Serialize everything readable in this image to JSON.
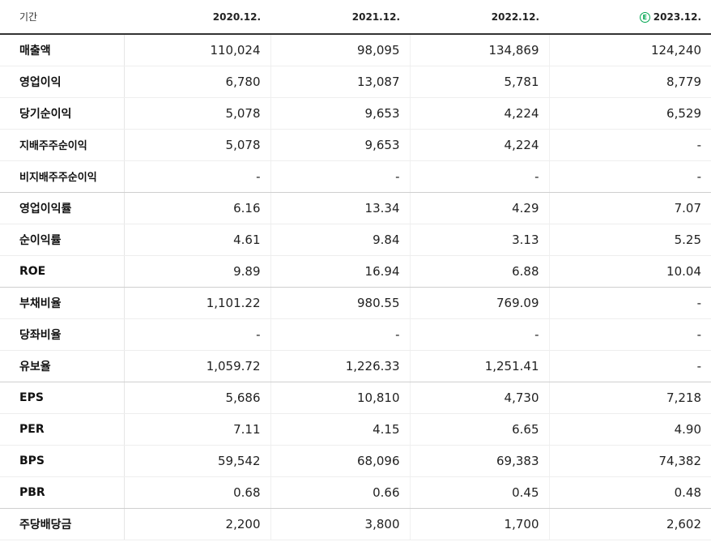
{
  "table": {
    "header": {
      "label": "기간",
      "periods": [
        "2020.12.",
        "2021.12.",
        "2022.12.",
        "2023.12."
      ],
      "estimate_icon": "E"
    },
    "rows": [
      {
        "label": "매출액",
        "values": [
          "110,024",
          "98,095",
          "134,869",
          "124,240"
        ]
      },
      {
        "label": "영업이익",
        "values": [
          "6,780",
          "13,087",
          "5,781",
          "8,779"
        ]
      },
      {
        "label": "당기순이익",
        "values": [
          "5,078",
          "9,653",
          "4,224",
          "6,529"
        ]
      },
      {
        "label": "지배주주순이익",
        "values": [
          "5,078",
          "9,653",
          "4,224",
          "-"
        ]
      },
      {
        "label": "비지배주주순이익",
        "values": [
          "-",
          "-",
          "-",
          "-"
        ]
      },
      {
        "label": "영업이익률",
        "values": [
          "6.16",
          "13.34",
          "4.29",
          "7.07"
        ]
      },
      {
        "label": "순이익률",
        "values": [
          "4.61",
          "9.84",
          "3.13",
          "5.25"
        ]
      },
      {
        "label": "ROE",
        "values": [
          "9.89",
          "16.94",
          "6.88",
          "10.04"
        ]
      },
      {
        "label": "부채비율",
        "values": [
          "1,101.22",
          "980.55",
          "769.09",
          "-"
        ]
      },
      {
        "label": "당좌비율",
        "values": [
          "-",
          "-",
          "-",
          "-"
        ]
      },
      {
        "label": "유보율",
        "values": [
          "1,059.72",
          "1,226.33",
          "1,251.41",
          "-"
        ]
      },
      {
        "label": "EPS",
        "values": [
          "5,686",
          "10,810",
          "4,730",
          "7,218"
        ]
      },
      {
        "label": "PER",
        "values": [
          "7.11",
          "4.15",
          "6.65",
          "4.90"
        ]
      },
      {
        "label": "BPS",
        "values": [
          "59,542",
          "68,096",
          "69,383",
          "74,382"
        ]
      },
      {
        "label": "PBR",
        "values": [
          "0.68",
          "0.66",
          "0.45",
          "0.48"
        ]
      },
      {
        "label": "주당배당금",
        "values": [
          "2,200",
          "3,800",
          "1,700",
          "2,602"
        ]
      }
    ]
  },
  "colors": {
    "estimate_accent": "#00a650",
    "header_rule": "#333333",
    "group_rule": "#cfcfcf",
    "row_rule": "#eeeeee"
  }
}
